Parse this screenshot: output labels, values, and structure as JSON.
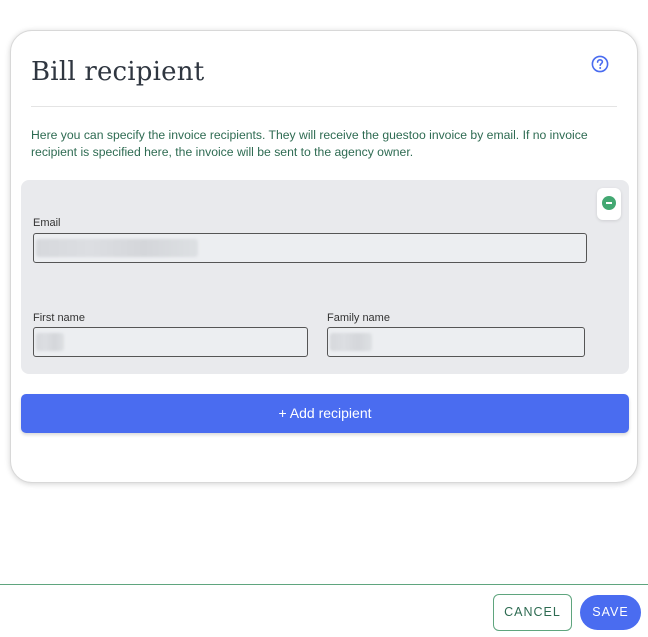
{
  "dialog": {
    "title": "Bill recipient",
    "help_icon": "question-circle-icon",
    "description": "Here you can specify the invoice recipients. They will receive the guestoo invoice by email. If no invoice recipient is specified here, the invoice will be sent to the agency owner."
  },
  "recipient": {
    "remove_icon": "minus-circle-icon",
    "email_label": "Email",
    "email_value": "",
    "first_name_label": "First name",
    "first_name_value": "",
    "family_name_label": "Family name",
    "family_name_value": ""
  },
  "add_button_label": "+ Add recipient",
  "footer": {
    "cancel_label": "CANCEL",
    "save_label": "SAVE"
  },
  "colors": {
    "accent": "#4a6cf0",
    "green": "#43a872",
    "text_green": "#2e6b52"
  }
}
